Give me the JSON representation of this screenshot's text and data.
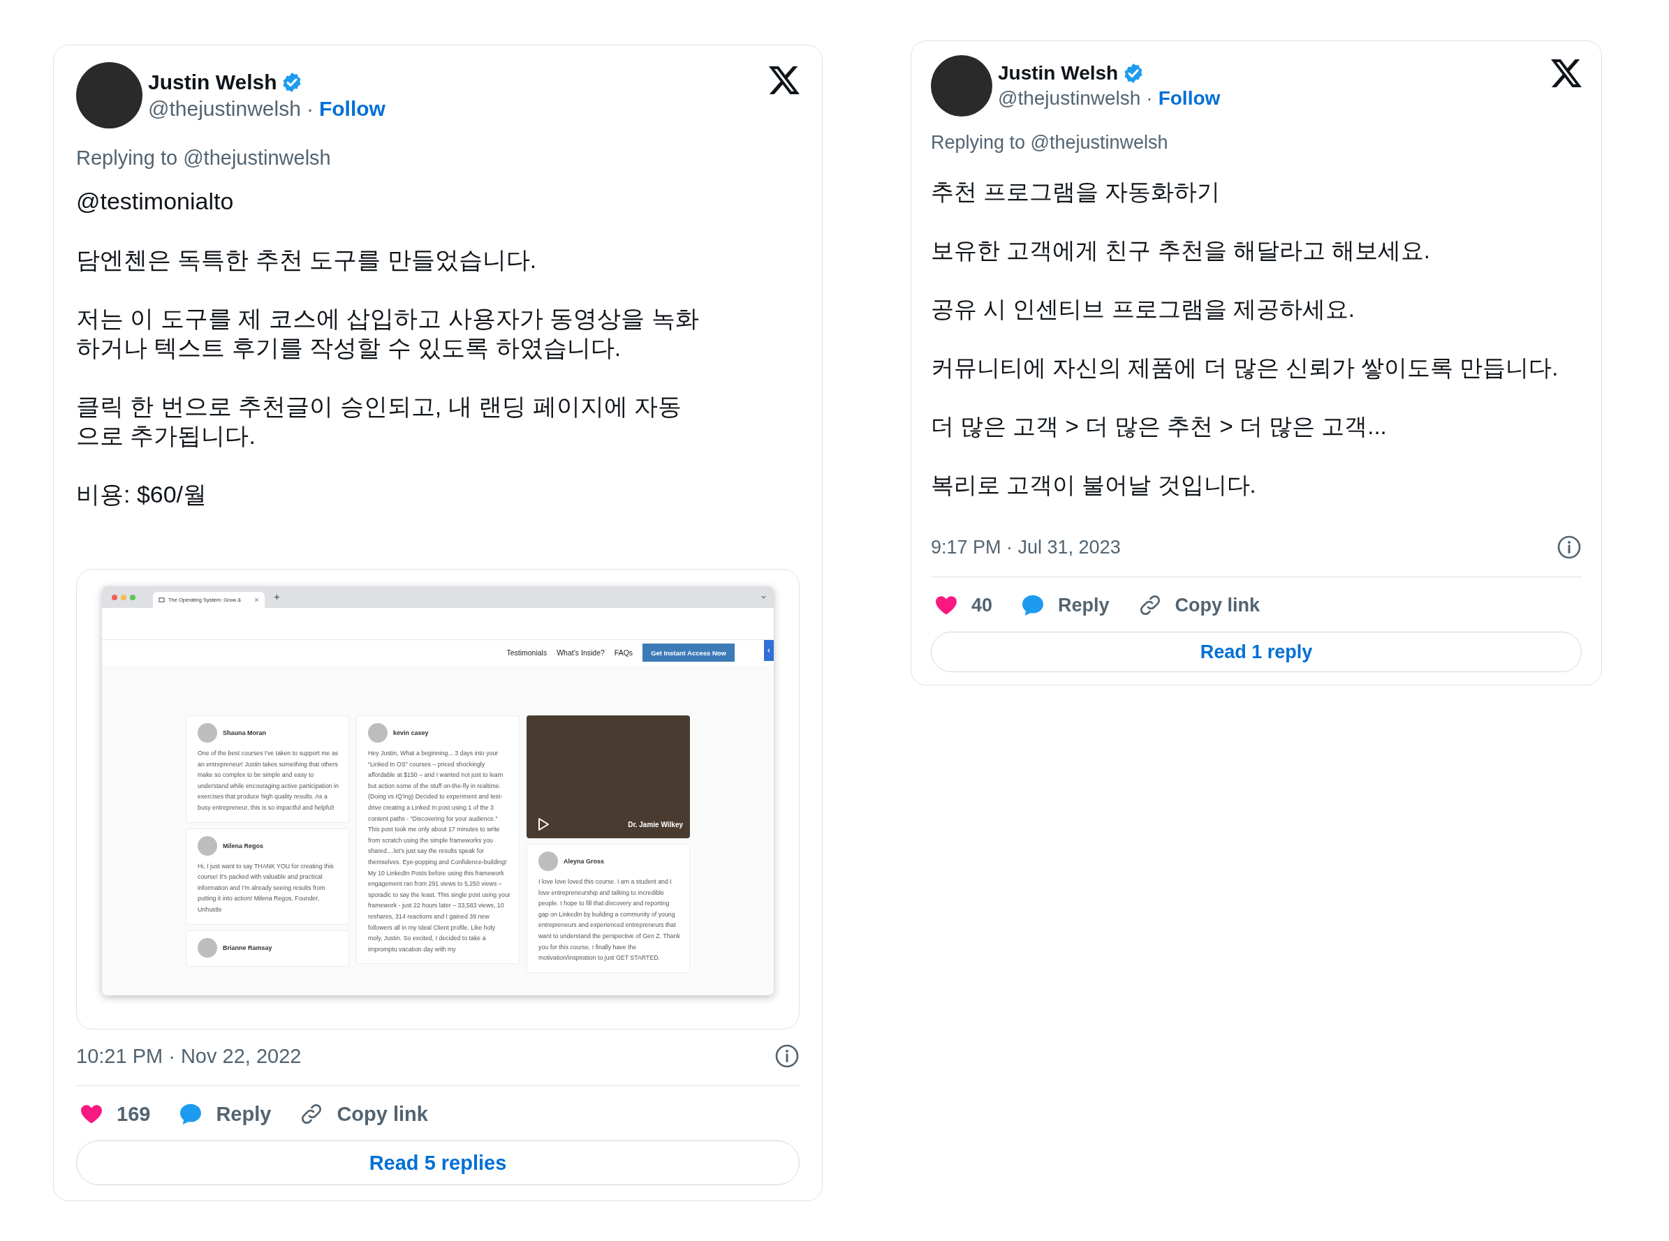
{
  "tweets": [
    {
      "author": "Justin Welsh",
      "verified": true,
      "handle": "@thejustinwelsh",
      "separator": "·",
      "follow": "Follow",
      "replying_to": "Replying to @thejustinwelsh",
      "paragraphs": [
        "@testimonialto",
        "담엔첸은 독특한 추천 도구를 만들었습니다.",
        "저는 이 도구를 제 코스에 삽입하고 사용자가 동영상을 녹화하거나 텍스트 후기를 작성할 수 있도록 하였습니다.",
        "클릭 한 번으로 추천글이 승인되고, 내 랜딩 페이지에 자동으로 추가됩니다.",
        "비용: $60/월"
      ],
      "media": {
        "tab_title": "The Operating System: Grow &",
        "nav_links": [
          "Testimonials",
          "What’s Inside?",
          "FAQs"
        ],
        "cta": "Get Instant Access Now",
        "columns": [
          [
            {
              "kind": "text",
              "name": "Shauna Moran",
              "text": "One of the best courses I've taken to support me as an entrepreneur! Justin takes something that others make so complex to be simple and easy to understand while encouraging active participation in exercises that produce high quality results. As a busy entrepreneur, this is so impactful and helpful!"
            },
            {
              "kind": "text",
              "name": "Milena Regos",
              "text": "Hi, I just want to say THANK YOU for creating this course! It's packed with valuable and practical information and I'm already seeing results from putting it into action! Milena Regos, Founder, Unhustle"
            },
            {
              "kind": "text",
              "name": "Brianne Ramsay"
            }
          ],
          [
            {
              "kind": "text",
              "name": "kevin casey",
              "text": "Hey Justin, What a beginning... 3 days into your “Linked In OS” courses – priced shockingly affordable at $150 – and I wanted not just to learn but action some of the stuff on-the-fly in realtime. (Doing vs IQ'ing) Decided to experiment and test-drive creating a Linked In post using 1 of the 3 content paths - “Discovering for your audience.” This post took me only about 17 minutes to write from scratch using the simple frameworks you shared....let's just say the results speak for themselves. Eye-popping and Confidence-building! My 10 LinkedIn Posts before using this framework engagement ran from 291 views to 5,250 views – sporadic to say the least. This single post using your framework - just 22 hours later – 33,583 views, 10 reshares, 314 reactions and I gained 39 new followers all in my Ideal Client profile. Like holy moly, Justin. So excited, I decided to take a impromptu vacation day with my"
            }
          ],
          [
            {
              "kind": "video",
              "name": "Dr. Jamie Wilkey"
            },
            {
              "kind": "text",
              "name": "Aleyna Gross",
              "text": "I love love loved this course. I am a student and I love entrepreneurship and talking to incredible people. I hope to fill that discovery and reporting gap on LinkedIn by building a community of young entrepreneurs and experienced entrepreneurs that want to understand the perspective of Gen Z. Thank you for this course, I finally have the motivation/inspiration to just GET STARTED."
            }
          ]
        ]
      },
      "time": "10:21 PM · Nov 22, 2022",
      "likes": "169",
      "reply": "Reply",
      "copy_link": "Copy link",
      "read_replies": "Read 5 replies"
    },
    {
      "author": "Justin Welsh",
      "verified": true,
      "handle": "@thejustinwelsh",
      "separator": "·",
      "follow": "Follow",
      "replying_to": "Replying to @thejustinwelsh",
      "paragraphs": [
        "추천 프로그램을 자동화하기",
        "보유한 고객에게 친구 추천을 해달라고 해보세요.",
        "공유 시 인센티브 프로그램을 제공하세요.",
        "커뮤니티에 자신의 제품에 더 많은 신뢰가 쌓이도록 만듭니다.",
        "더 많은 고객 > 더 많은 추천 > 더 많은 고객...",
        "복리로 고객이 불어날 것입니다."
      ],
      "time": "9:17 PM · Jul 31, 2023",
      "likes": "40",
      "reply": "Reply",
      "copy_link": "Copy link",
      "read_replies": "Read 1 reply"
    }
  ]
}
